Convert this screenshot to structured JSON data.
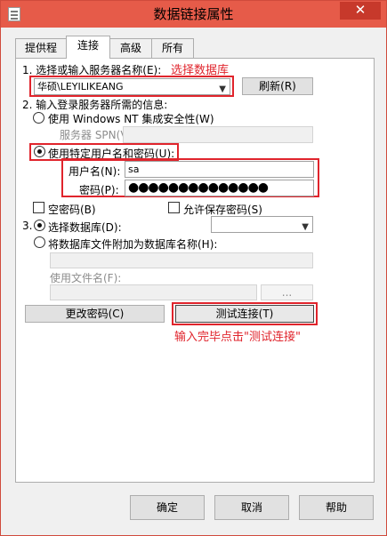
{
  "window": {
    "title": "数据链接属性",
    "close_glyph": "✕"
  },
  "tabs": [
    {
      "label": "提供程序"
    },
    {
      "label": "连接"
    },
    {
      "label": "高级"
    },
    {
      "label": "所有"
    }
  ],
  "step1": {
    "label": "1. 选择或输入服务器名称(E):",
    "annotation": "选择数据库",
    "server_value": "华硕\\LEYILIKEANG",
    "refresh_label": "刷新(R)"
  },
  "step2": {
    "label": "2. 输入登录服务器所需的信息:",
    "nt_security_label": "使用 Windows NT 集成安全性(W)",
    "spn_label": "服务器 SPN(V):",
    "spn_value": "",
    "specific_user_label": "使用特定用户名和密码(U):",
    "username_label": "用户名(N):",
    "username_value": "sa",
    "password_label": "密码(P):",
    "password_value": "●●●●●●●●●●●●●●",
    "blank_password_label": "空密码(B)",
    "allow_save_label": "允许保存密码(S)"
  },
  "step3": {
    "label": "3.",
    "select_db_label": "选择数据库(D):",
    "select_db_value": "",
    "attach_label": "将数据库文件附加为数据库名称(H):",
    "attach_value": "",
    "filename_label": "使用文件名(F):",
    "filename_value": "",
    "browse_label": "..."
  },
  "actions": {
    "change_password_label": "更改密码(C)",
    "test_connection_label": "测试连接(T)",
    "annotation": "输入完毕点击\"测试连接\""
  },
  "footer": {
    "ok_label": "确定",
    "cancel_label": "取消",
    "help_label": "帮助"
  },
  "colors": {
    "titlebar": "#e65b49",
    "annotation": "#e0242c"
  }
}
